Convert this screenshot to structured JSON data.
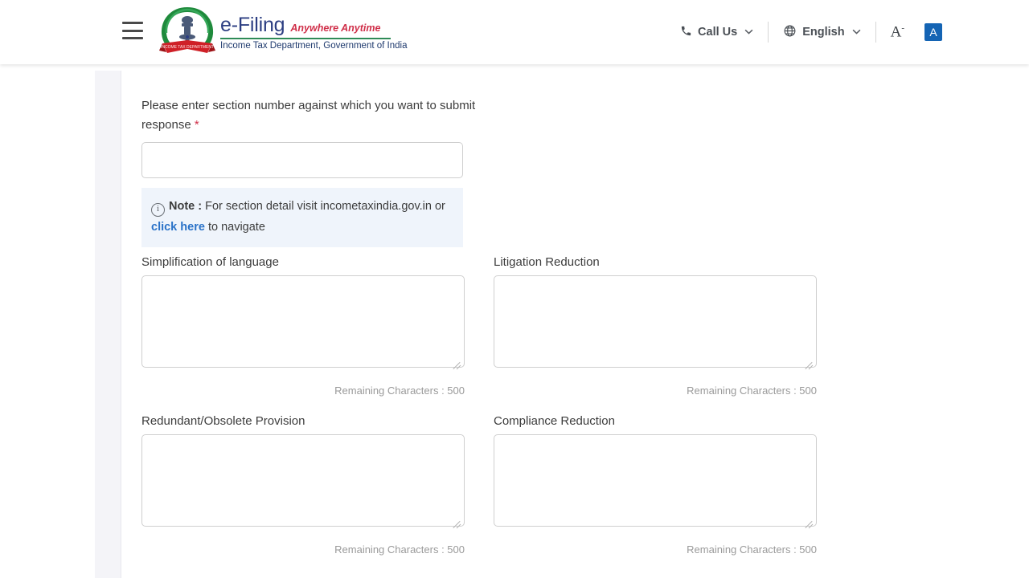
{
  "header": {
    "menu_icon": "hamburger-menu-icon",
    "brand": {
      "emblem": "india-emblem-logo",
      "title": "e-Filing",
      "tagline": "Anywhere Anytime",
      "subtitle": "Income Tax Department, Government of India"
    },
    "call_us": {
      "icon": "phone-icon",
      "label": "Call Us",
      "chevron": "⌄"
    },
    "language": {
      "icon": "globe-icon",
      "label": "English",
      "chevron": "⌄"
    },
    "font_decrease": {
      "label": "A",
      "sup": "-"
    },
    "accessibility": {
      "label": "A",
      "color": "#1464b4"
    }
  },
  "form": {
    "section_number": {
      "label": "Please enter section number against which you want to submit response",
      "required_mark": "*",
      "value": "",
      "placeholder": ""
    },
    "note": {
      "icon": "info-icon",
      "bold": "Note :",
      "text_before": " For section detail visit incometaxindia.gov.in or ",
      "link": "click here",
      "text_after": " to navigate"
    },
    "remaining_label": "Remaining Characters : 500",
    "fields": [
      {
        "label": "Simplification of language",
        "value": "",
        "placeholder": "",
        "remaining": "Remaining Characters : 500"
      },
      {
        "label": "Litigation Reduction",
        "value": "",
        "placeholder": "",
        "remaining": "Remaining Characters : 500"
      },
      {
        "label": "Redundant/Obsolete Provision",
        "value": "",
        "placeholder": "",
        "remaining": "Remaining Characters : 500"
      },
      {
        "label": "Compliance Reduction",
        "value": "",
        "placeholder": "",
        "remaining": "Remaining Characters : 500"
      }
    ]
  },
  "colors": {
    "brand_blue": "#2c3e82",
    "tagline_red": "#d0304a",
    "rule_green": "#2e8b57",
    "link_blue": "#2a72c8",
    "note_bg": "#eff4fb",
    "accent": "#1464b4"
  }
}
